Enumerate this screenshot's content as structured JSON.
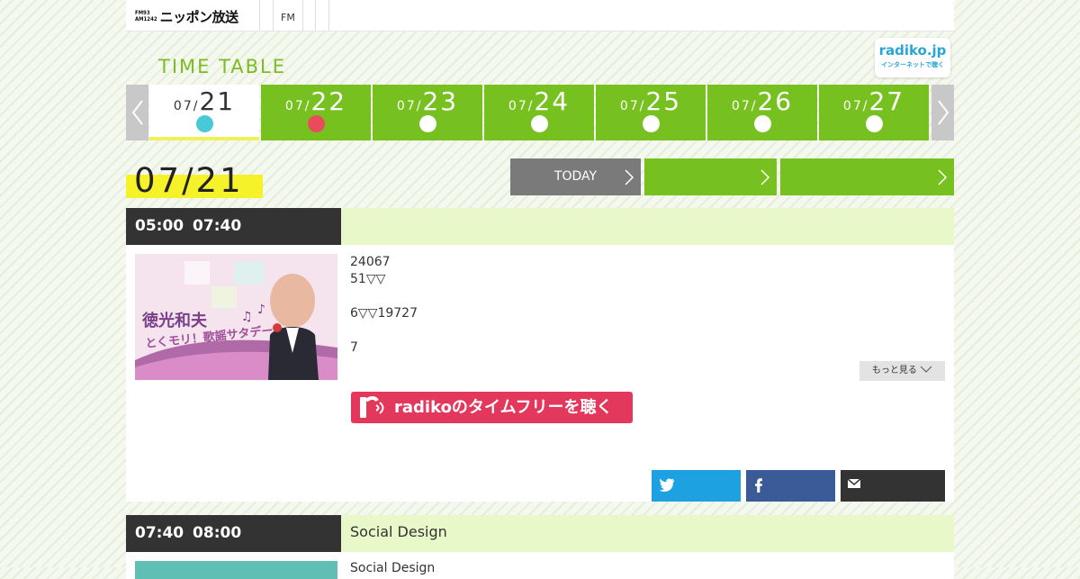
{
  "header": {
    "logo_badge_line1": "FM93",
    "logo_badge_line2": "AM1242",
    "logo_text": "ニッポン放送",
    "fm_link": "FM"
  },
  "timetable_title": "TIME TABLE",
  "radiko_badge": {
    "line1": "radiko.jp",
    "line2": "インターネットで聴く"
  },
  "days": [
    {
      "month": "07/",
      "day": "21",
      "active": true,
      "dot": "cyan"
    },
    {
      "month": "07/",
      "day": "22",
      "active": false,
      "dot": "red"
    },
    {
      "month": "07/",
      "day": "23",
      "active": false,
      "dot": "white"
    },
    {
      "month": "07/",
      "day": "24",
      "active": false,
      "dot": "white"
    },
    {
      "month": "07/",
      "day": "25",
      "active": false,
      "dot": "white"
    },
    {
      "month": "07/",
      "day": "26",
      "active": false,
      "dot": "white"
    },
    {
      "month": "07/",
      "day": "27",
      "active": false,
      "dot": "white"
    }
  ],
  "nav": {
    "prev_icon": "chevron-left-icon",
    "next_icon": "chevron-right-icon"
  },
  "current_date": "07/21",
  "buttons": {
    "today": "TODAY",
    "next1": "",
    "next2": ""
  },
  "programs": [
    {
      "start": "05:00",
      "end": "07:40",
      "title": "",
      "description": [
        "24067",
        "51▽▽",
        "",
        "6▽▽19727",
        "",
        "7"
      ],
      "more_label": "もっと見る",
      "radiko_label": "radikoのタイムフリーを聴く",
      "thumb_title": "徳光和夫",
      "thumb_subtitle": "とくモリ！歌謡サタデー",
      "share": [
        "twitter-icon",
        "facebook-icon",
        "mail-icon"
      ]
    },
    {
      "start": "07:40",
      "end": "08:00",
      "title": "Social Design",
      "description": [
        "Social Design"
      ]
    }
  ],
  "colors": {
    "green": "#76c11f",
    "dark": "#333333",
    "radiko_red": "#e3375c",
    "twitter": "#1da1e0",
    "facebook": "#3b5b98",
    "highlight_yellow": "#f5f22a",
    "title_bar_bg": "#e8f8c8"
  }
}
